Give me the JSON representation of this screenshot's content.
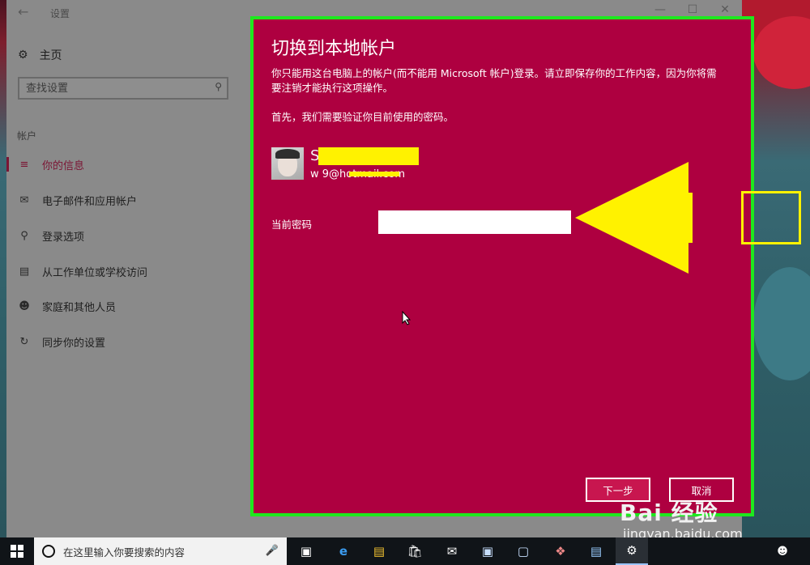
{
  "window": {
    "title": "设置",
    "back_icon": "arrow-left-icon",
    "controls": [
      "minimize",
      "maximize",
      "close"
    ]
  },
  "sidebar": {
    "home_label": "主页",
    "search_placeholder": "查找设置",
    "section_label": "帐户",
    "items": [
      {
        "label": "你的信息",
        "icon": "person-card-icon",
        "active": true
      },
      {
        "label": "电子邮件和应用帐户",
        "icon": "mail-icon",
        "active": false
      },
      {
        "label": "登录选项",
        "icon": "key-icon",
        "active": false
      },
      {
        "label": "从工作单位或学校访问",
        "icon": "briefcase-icon",
        "active": false
      },
      {
        "label": "家庭和其他人员",
        "icon": "people-icon",
        "active": false
      },
      {
        "label": "同步你的设置",
        "icon": "sync-icon",
        "active": false
      }
    ]
  },
  "dialog": {
    "title": "切换到本地帐户",
    "description": "你只能用这台电脑上的帐户(而不能用 Microsoft 帐户)登录。请立即保存你的工作内容，因为你将需要注销才能执行这项操作。",
    "first_step": "首先，我们需要验证你目前使用的密码。",
    "account_name": "S                    u",
    "account_email": "w                 9@hotmail.com",
    "password_label": "当前密码",
    "password_value": "",
    "next_label": "下一步",
    "cancel_label": "取消"
  },
  "taskbar": {
    "search_placeholder": "在这里输入你要搜索的内容",
    "apps": [
      "task-view-icon",
      "edge-icon",
      "file-explorer-icon",
      "store-icon",
      "mail-icon",
      "photos-icon",
      "app-icon",
      "paint-icon",
      "remote-desktop-icon",
      "settings-icon"
    ]
  },
  "watermark": {
    "brand": "Bai 经验",
    "url": "jingyan.baidu.com"
  },
  "colors": {
    "dialog_bg": "#ae0040",
    "dialog_border": "#1ee81e",
    "annotation": "#fff200",
    "accent": "#7b1534"
  }
}
